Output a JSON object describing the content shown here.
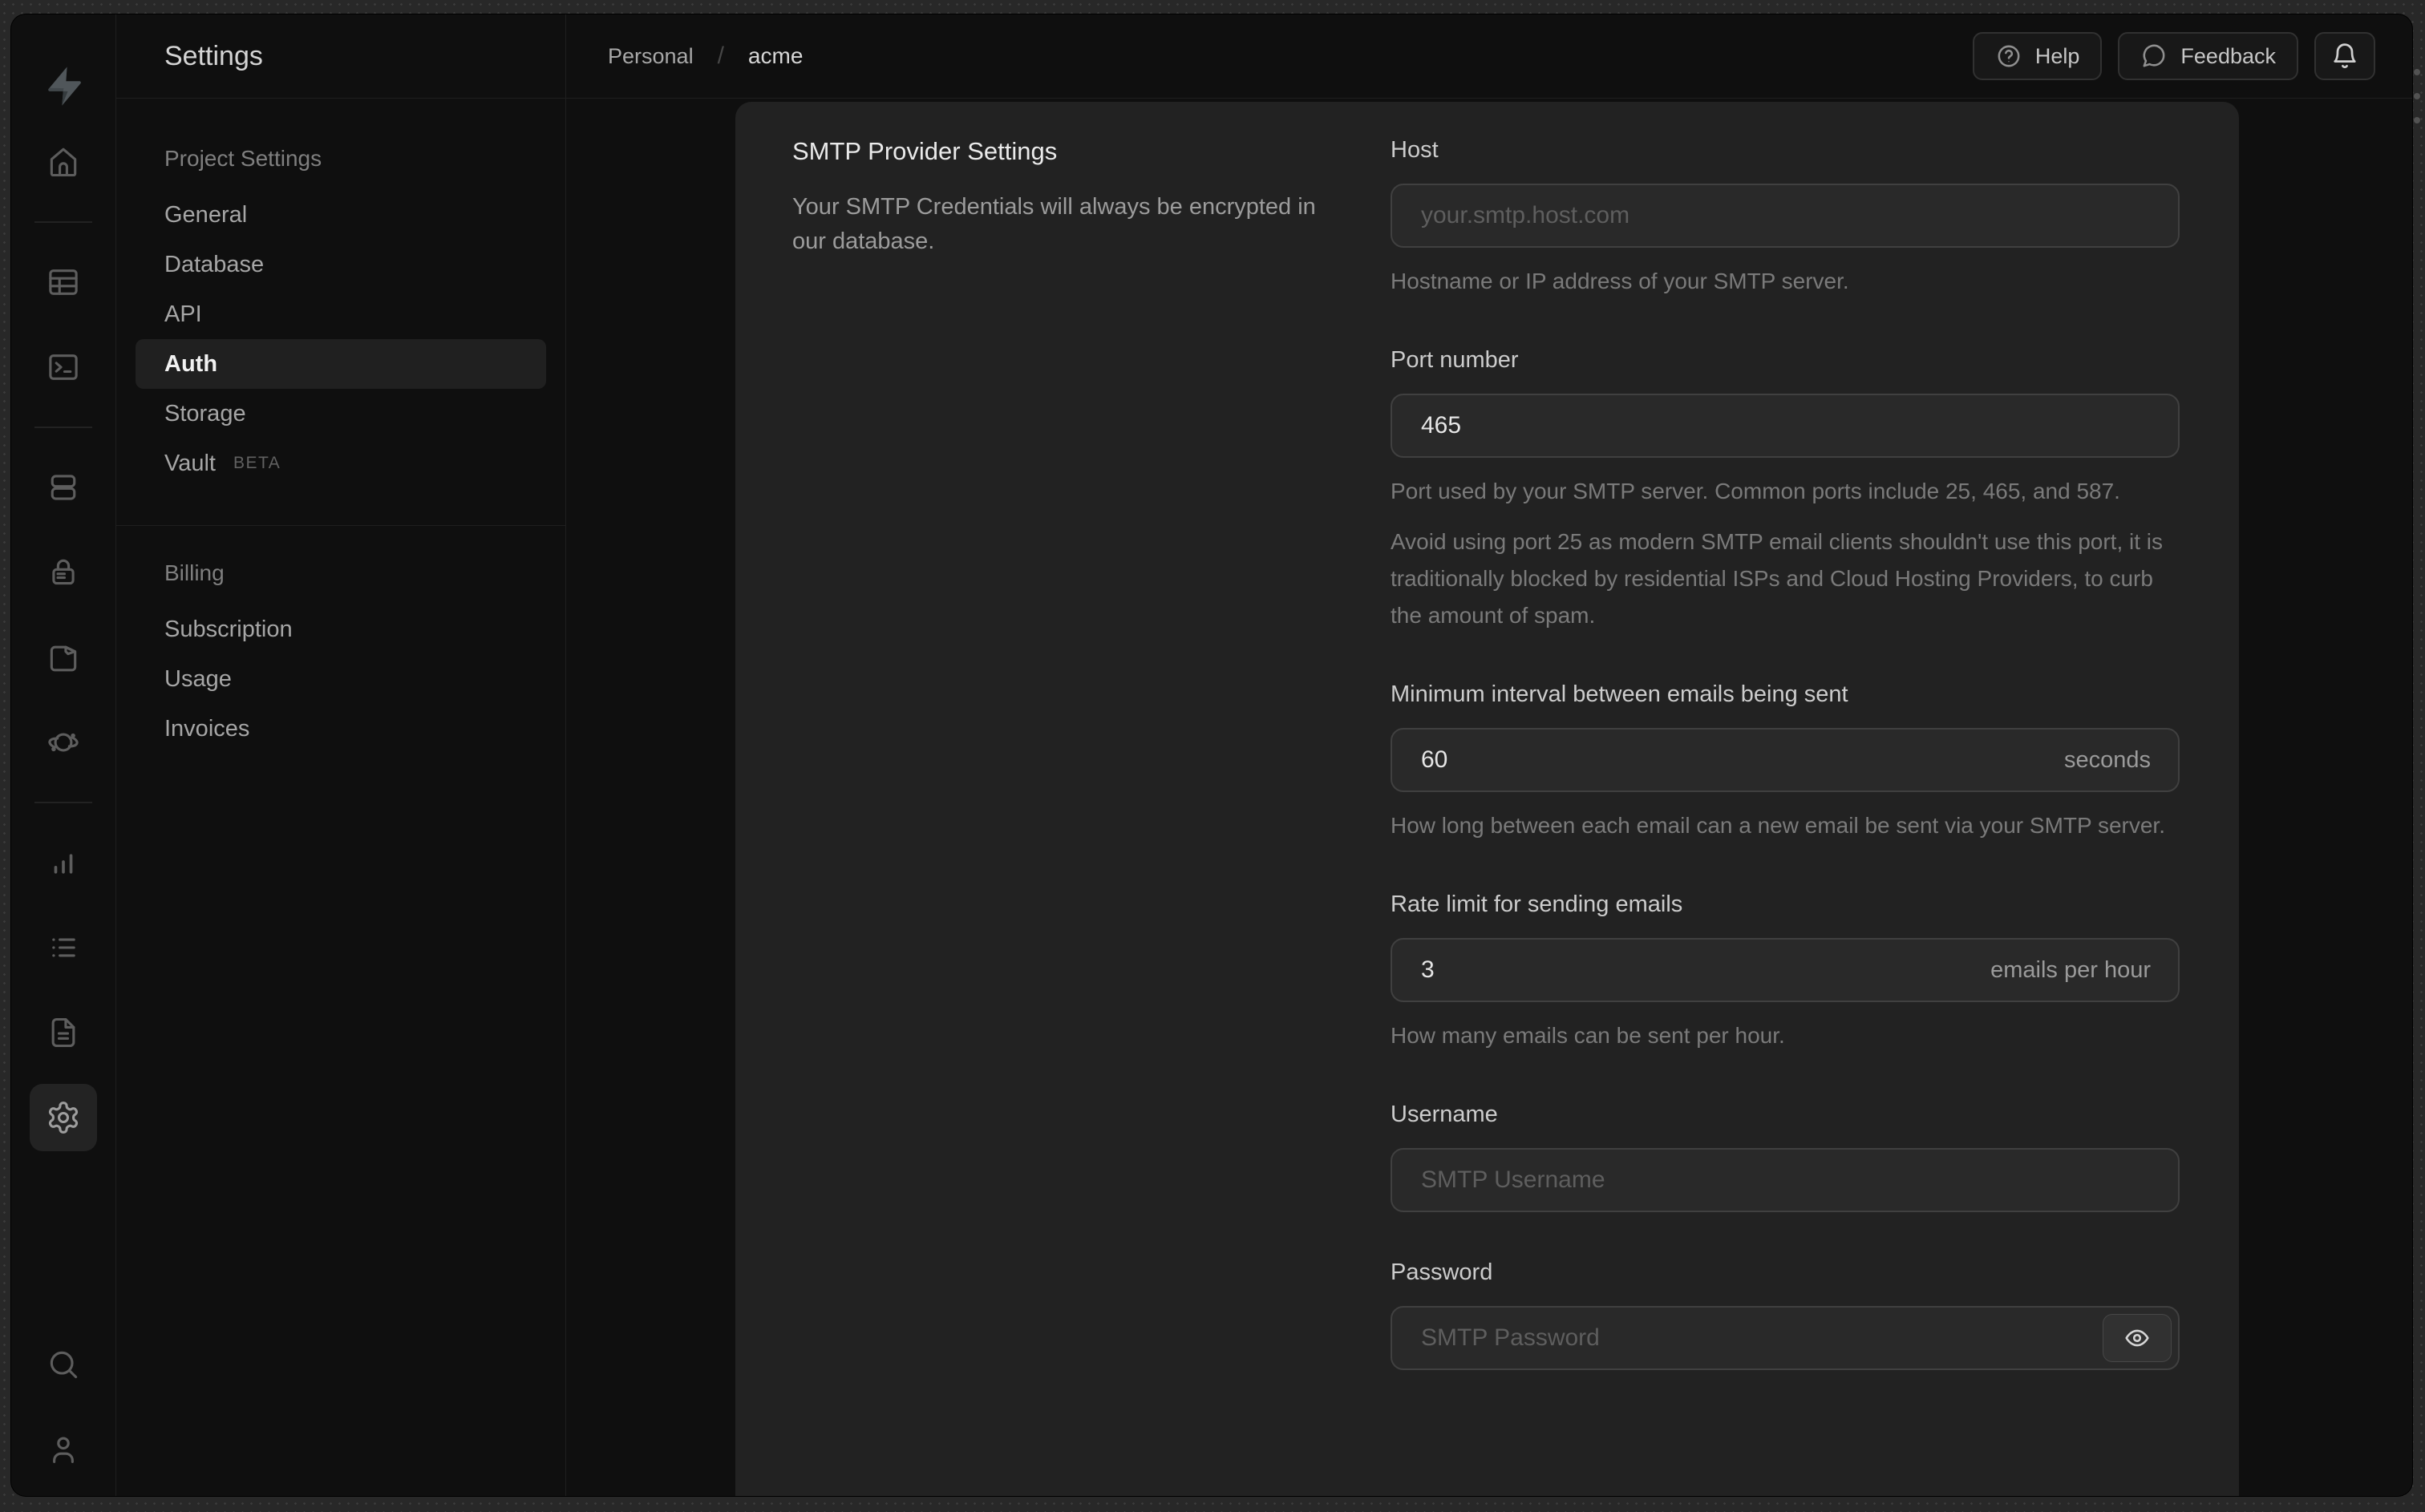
{
  "sidebar": {
    "title": "Settings",
    "sections": [
      {
        "title": "Project Settings",
        "items": [
          {
            "label": "General"
          },
          {
            "label": "Database"
          },
          {
            "label": "API"
          },
          {
            "label": "Auth",
            "active": true
          },
          {
            "label": "Storage"
          },
          {
            "label": "Vault",
            "badge": "BETA"
          }
        ]
      },
      {
        "title": "Billing",
        "items": [
          {
            "label": "Subscription"
          },
          {
            "label": "Usage"
          },
          {
            "label": "Invoices"
          }
        ]
      }
    ]
  },
  "nav_rail": {
    "icons": [
      "supabase-logo",
      "home",
      "table-editor",
      "sql-editor",
      "database",
      "auth",
      "storage",
      "edge-functions",
      "reports",
      "logs",
      "api-docs",
      "settings",
      "search",
      "profile"
    ],
    "active_icon": "settings"
  },
  "topbar": {
    "breadcrumb": {
      "org": "Personal",
      "separator": "/",
      "project": "acme"
    },
    "actions": {
      "help": "Help",
      "feedback": "Feedback",
      "bell_icon": "notifications-bell"
    }
  },
  "panel": {
    "title": "SMTP Provider Settings",
    "description": "Your SMTP Credentials will always be encrypted in our database.",
    "form": {
      "host": {
        "label": "Host",
        "placeholder": "your.smtp.host.com",
        "help": "Hostname or IP address of your SMTP server."
      },
      "port": {
        "label": "Port number",
        "value": "465",
        "help": "Port used by your SMTP server. Common ports include 25, 465, and 587.",
        "note": "Avoid using port 25 as modern SMTP email clients shouldn't use this port, it is traditionally blocked by residential ISPs and Cloud Hosting Providers, to curb the amount of spam."
      },
      "interval": {
        "label": "Minimum interval between emails being sent",
        "value": "60",
        "suffix": "seconds",
        "help": "How long between each email can a new email be sent via your SMTP server."
      },
      "rate": {
        "label": "Rate limit for sending emails",
        "value": "3",
        "suffix": "emails per hour",
        "help": "How many emails can be sent per hour."
      },
      "username": {
        "label": "Username",
        "placeholder": "SMTP Username"
      },
      "password": {
        "label": "Password",
        "placeholder": "SMTP Password"
      }
    }
  },
  "colors": {
    "panel_bg": "#222222",
    "page_bg": "#0f0f0f",
    "input_bg": "#292929",
    "input_border": "#404040",
    "active_item_bg": "#202020",
    "text_primary": "#eaeaea",
    "text_secondary": "#9c9c9c",
    "text_help": "#7a7a7a"
  }
}
